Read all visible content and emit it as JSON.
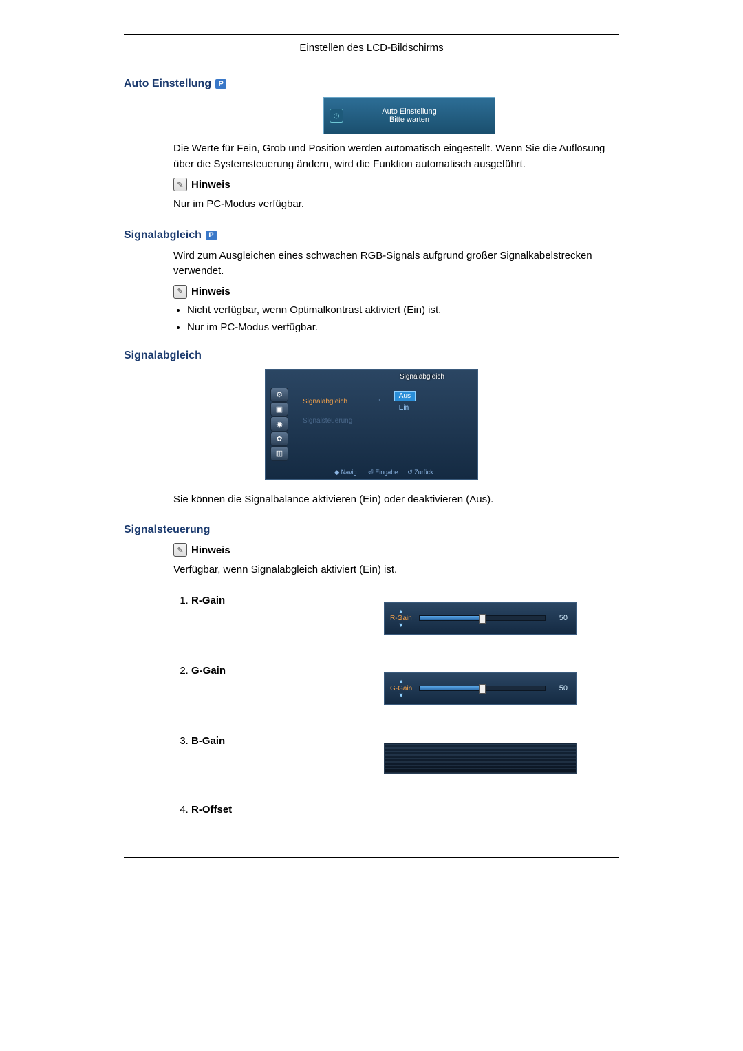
{
  "header": {
    "title": "Einstellen des LCD-Bildschirms"
  },
  "badge": {
    "p": "P"
  },
  "sections": {
    "auto_einstellung": {
      "title": "Auto Einstellung",
      "wait_box": {
        "line1": "Auto Einstellung",
        "line2": "Bitte warten"
      },
      "body": "Die Werte für Fein, Grob und Position werden automatisch eingestellt. Wenn Sie die Auflösung über die Systemsteuerung ändern, wird die Funktion automatisch ausgeführt.",
      "hinweis_label": "Hinweis",
      "note": "Nur im PC-Modus verfügbar."
    },
    "signalabgleich_top": {
      "title": "Signalabgleich",
      "body": "Wird zum Ausgleichen eines schwachen RGB-Signals aufgrund großer Signalkabelstrecken verwendet.",
      "hinweis_label": "Hinweis",
      "bullets": [
        "Nicht verfügbar, wenn Optimalkontrast aktiviert (Ein) ist.",
        "Nur im PC-Modus verfügbar."
      ]
    },
    "signalabgleich_osd": {
      "title": "Signalabgleich",
      "osd": {
        "panel_title": "Signalabgleich",
        "row1_label": "Signalabgleich",
        "row2_label": "Signalsteuerung",
        "opt_aus": "Aus",
        "opt_ein": "Ein",
        "footer_navig": "Navig.",
        "footer_eingabe": "Eingabe",
        "footer_zurueck": "Zurück"
      },
      "body": "Sie können die Signalbalance aktivieren (Ein) oder deaktivieren (Aus)."
    },
    "signalsteuerung": {
      "title": "Signalsteuerung",
      "hinweis_label": "Hinweis",
      "body": "Verfügbar, wenn Signalabgleich aktiviert (Ein) ist.",
      "items": [
        {
          "label": "R-Gain",
          "slider": {
            "name": "R-Gain",
            "value": "50"
          }
        },
        {
          "label": "G-Gain",
          "slider": {
            "name": "G-Gain",
            "value": "50"
          }
        },
        {
          "label": "B-Gain",
          "slider": null
        },
        {
          "label": "R-Offset",
          "slider": null
        }
      ]
    }
  },
  "chart_data": {
    "type": "table",
    "title": "Signalsteuerung slider values",
    "categories": [
      "R-Gain",
      "G-Gain"
    ],
    "values": [
      50,
      50
    ],
    "range": [
      0,
      100
    ]
  }
}
